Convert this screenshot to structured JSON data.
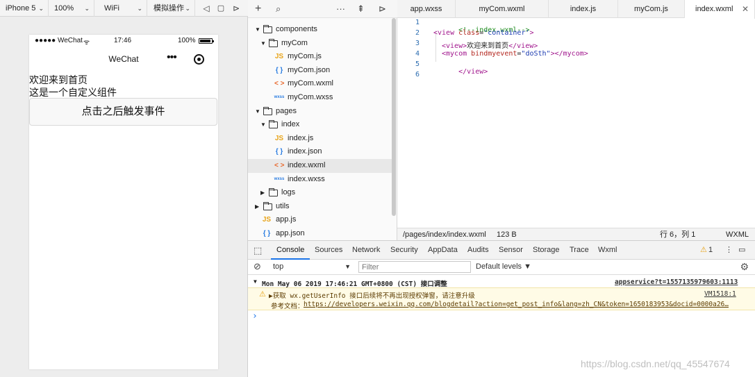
{
  "simulator": {
    "toolbar": {
      "device": "iPhone 5",
      "zoom": "100%",
      "network": "WiFi",
      "operation": "模拟操作"
    },
    "status_bar": {
      "carrier": "●●●●● WeChat",
      "wifi_glyph": "ᯤ",
      "time": "17:46",
      "battery": "100%"
    },
    "nav": {
      "title": "WeChat",
      "dots": "•••"
    },
    "page": {
      "welcome": "欢迎来到首页",
      "component_text": "这是一个自定义组件",
      "button_label": "点击之后触发事件"
    }
  },
  "file_tree": {
    "nodes": [
      {
        "label": "components",
        "type": "folder"
      },
      {
        "label": "myCom",
        "type": "folder"
      },
      {
        "label": "myCom.js",
        "type": "js",
        "icon": "JS"
      },
      {
        "label": "myCom.json",
        "type": "json",
        "icon": "{ }"
      },
      {
        "label": "myCom.wxml",
        "type": "wxml",
        "icon": "< >"
      },
      {
        "label": "myCom.wxss",
        "type": "wxss",
        "icon": "wxss"
      },
      {
        "label": "pages",
        "type": "folder"
      },
      {
        "label": "index",
        "type": "folder"
      },
      {
        "label": "index.js",
        "type": "js",
        "icon": "JS"
      },
      {
        "label": "index.json",
        "type": "json",
        "icon": "{ }"
      },
      {
        "label": "index.wxml",
        "type": "wxml",
        "icon": "< >"
      },
      {
        "label": "index.wxss",
        "type": "wxss",
        "icon": "wxss"
      },
      {
        "label": "logs",
        "type": "folder"
      },
      {
        "label": "utils",
        "type": "folder"
      },
      {
        "label": "app.js",
        "type": "js",
        "icon": "JS"
      },
      {
        "label": "app.json",
        "type": "json",
        "icon": "{ }"
      }
    ]
  },
  "editor": {
    "tabs": [
      "app.wxss",
      "myCom.wxml",
      "index.js",
      "myCom.js",
      "index.wxml"
    ],
    "close_glyph": "✕",
    "line_numbers": [
      "1",
      "2",
      "3",
      "4",
      "5",
      "6"
    ],
    "code": {
      "l1": "<!--index.wxml-->",
      "l2_open": "<view ",
      "l2_attr": "class",
      "l2_eq": "=",
      "l2_val": "'container'",
      "l2_close": ">",
      "l3_open": "<view>",
      "l3_text": "欢迎来到首页",
      "l3_close": "</view>",
      "l4_open": "<mycom ",
      "l4_attr": "bindmyevent",
      "l4_eq": "=",
      "l4_val": "\"doSth\"",
      "l4_close": "></mycom>",
      "l5": "</view>"
    },
    "status": {
      "path": "/pages/index/index.wxml",
      "size": "123 B",
      "cursor": "行 6，列 1",
      "lang": "WXML"
    }
  },
  "devtools": {
    "tabs": [
      "Console",
      "Sources",
      "Network",
      "Security",
      "AppData",
      "Audits",
      "Sensor",
      "Storage",
      "Trace",
      "Wxml"
    ],
    "warn_count": "1",
    "context": "top",
    "filter_placeholder": "Filter",
    "levels": "Default levels ▼",
    "log": {
      "group_title": "Mon May 06 2019 17:46:21 GMT+0800 (CST) 接口调整",
      "group_link": "appservice?t=1557135979603:1113",
      "warn_text": "▶获取 wx.getUserInfo 接口后续将不再出现授权弹窗，请注意升级",
      "warn_link": "VM1518:1",
      "doc_prefix": "参考文档：",
      "doc_url": "https://developers.weixin.qq.com/blogdetail?action=get_post_info&lang=zh_CN&token=1650183953&docid=0000a26…",
      "prompt": "›"
    }
  },
  "watermark": "https://blog.csdn.net/qq_45547674"
}
